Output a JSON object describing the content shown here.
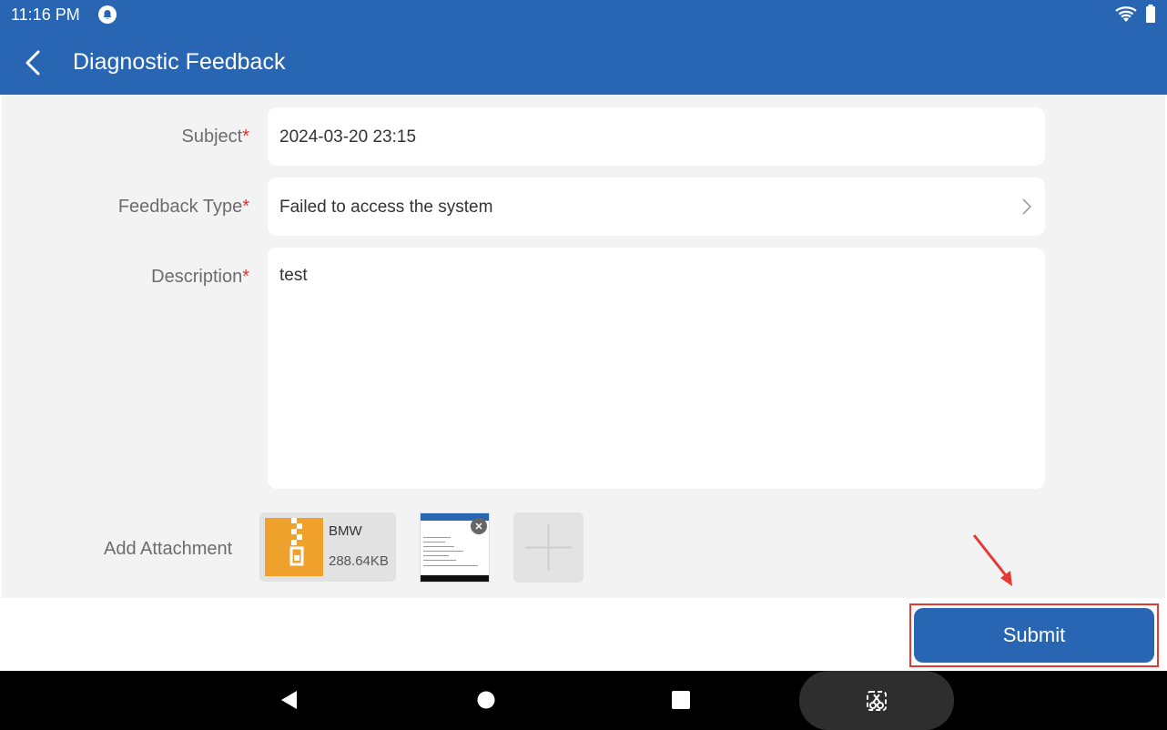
{
  "status_bar": {
    "time": "11:16 PM"
  },
  "header": {
    "title": "Diagnostic Feedback"
  },
  "form": {
    "subject": {
      "label": "Subject",
      "required_mark": "*",
      "value": "2024-03-20 23:15"
    },
    "feedback_type": {
      "label": "Feedback Type",
      "required_mark": "*",
      "value": "Failed to access the system"
    },
    "description": {
      "label": "Description",
      "required_mark": "*",
      "value": "test"
    },
    "attachments": {
      "label": "Add Attachment",
      "file": {
        "name": "BMW",
        "size": "288.64KB",
        "icon": "zip-file-icon"
      }
    }
  },
  "actions": {
    "submit_label": "Submit"
  },
  "colors": {
    "primary": "#2865b3",
    "required": "#e03131",
    "highlight": "#e53935",
    "zip_icon": "#f0a12b",
    "background": "#f3f3f3"
  }
}
